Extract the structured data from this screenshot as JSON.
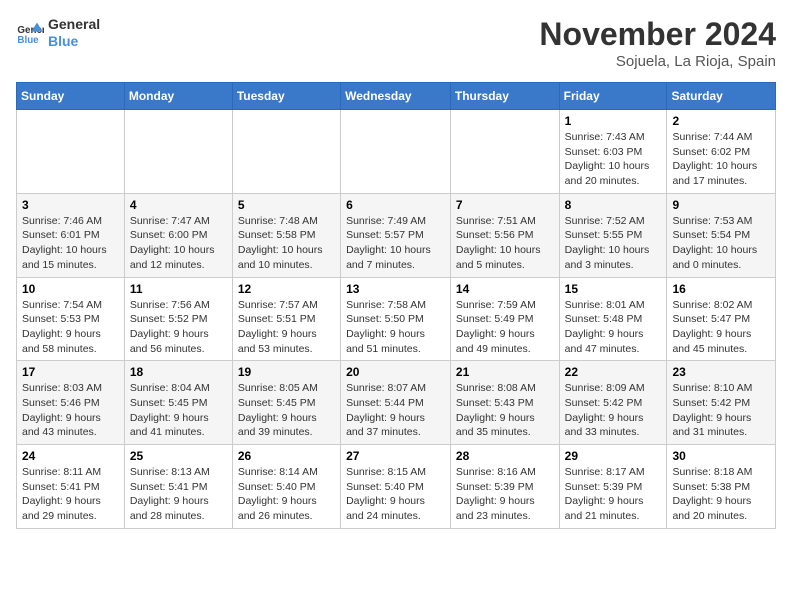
{
  "header": {
    "logo_line1": "General",
    "logo_line2": "Blue",
    "month": "November 2024",
    "location": "Sojuela, La Rioja, Spain"
  },
  "weekdays": [
    "Sunday",
    "Monday",
    "Tuesday",
    "Wednesday",
    "Thursday",
    "Friday",
    "Saturday"
  ],
  "weeks": [
    [
      {
        "day": "",
        "info": ""
      },
      {
        "day": "",
        "info": ""
      },
      {
        "day": "",
        "info": ""
      },
      {
        "day": "",
        "info": ""
      },
      {
        "day": "",
        "info": ""
      },
      {
        "day": "1",
        "info": "Sunrise: 7:43 AM\nSunset: 6:03 PM\nDaylight: 10 hours and 20 minutes."
      },
      {
        "day": "2",
        "info": "Sunrise: 7:44 AM\nSunset: 6:02 PM\nDaylight: 10 hours and 17 minutes."
      }
    ],
    [
      {
        "day": "3",
        "info": "Sunrise: 7:46 AM\nSunset: 6:01 PM\nDaylight: 10 hours and 15 minutes."
      },
      {
        "day": "4",
        "info": "Sunrise: 7:47 AM\nSunset: 6:00 PM\nDaylight: 10 hours and 12 minutes."
      },
      {
        "day": "5",
        "info": "Sunrise: 7:48 AM\nSunset: 5:58 PM\nDaylight: 10 hours and 10 minutes."
      },
      {
        "day": "6",
        "info": "Sunrise: 7:49 AM\nSunset: 5:57 PM\nDaylight: 10 hours and 7 minutes."
      },
      {
        "day": "7",
        "info": "Sunrise: 7:51 AM\nSunset: 5:56 PM\nDaylight: 10 hours and 5 minutes."
      },
      {
        "day": "8",
        "info": "Sunrise: 7:52 AM\nSunset: 5:55 PM\nDaylight: 10 hours and 3 minutes."
      },
      {
        "day": "9",
        "info": "Sunrise: 7:53 AM\nSunset: 5:54 PM\nDaylight: 10 hours and 0 minutes."
      }
    ],
    [
      {
        "day": "10",
        "info": "Sunrise: 7:54 AM\nSunset: 5:53 PM\nDaylight: 9 hours and 58 minutes."
      },
      {
        "day": "11",
        "info": "Sunrise: 7:56 AM\nSunset: 5:52 PM\nDaylight: 9 hours and 56 minutes."
      },
      {
        "day": "12",
        "info": "Sunrise: 7:57 AM\nSunset: 5:51 PM\nDaylight: 9 hours and 53 minutes."
      },
      {
        "day": "13",
        "info": "Sunrise: 7:58 AM\nSunset: 5:50 PM\nDaylight: 9 hours and 51 minutes."
      },
      {
        "day": "14",
        "info": "Sunrise: 7:59 AM\nSunset: 5:49 PM\nDaylight: 9 hours and 49 minutes."
      },
      {
        "day": "15",
        "info": "Sunrise: 8:01 AM\nSunset: 5:48 PM\nDaylight: 9 hours and 47 minutes."
      },
      {
        "day": "16",
        "info": "Sunrise: 8:02 AM\nSunset: 5:47 PM\nDaylight: 9 hours and 45 minutes."
      }
    ],
    [
      {
        "day": "17",
        "info": "Sunrise: 8:03 AM\nSunset: 5:46 PM\nDaylight: 9 hours and 43 minutes."
      },
      {
        "day": "18",
        "info": "Sunrise: 8:04 AM\nSunset: 5:45 PM\nDaylight: 9 hours and 41 minutes."
      },
      {
        "day": "19",
        "info": "Sunrise: 8:05 AM\nSunset: 5:45 PM\nDaylight: 9 hours and 39 minutes."
      },
      {
        "day": "20",
        "info": "Sunrise: 8:07 AM\nSunset: 5:44 PM\nDaylight: 9 hours and 37 minutes."
      },
      {
        "day": "21",
        "info": "Sunrise: 8:08 AM\nSunset: 5:43 PM\nDaylight: 9 hours and 35 minutes."
      },
      {
        "day": "22",
        "info": "Sunrise: 8:09 AM\nSunset: 5:42 PM\nDaylight: 9 hours and 33 minutes."
      },
      {
        "day": "23",
        "info": "Sunrise: 8:10 AM\nSunset: 5:42 PM\nDaylight: 9 hours and 31 minutes."
      }
    ],
    [
      {
        "day": "24",
        "info": "Sunrise: 8:11 AM\nSunset: 5:41 PM\nDaylight: 9 hours and 29 minutes."
      },
      {
        "day": "25",
        "info": "Sunrise: 8:13 AM\nSunset: 5:41 PM\nDaylight: 9 hours and 28 minutes."
      },
      {
        "day": "26",
        "info": "Sunrise: 8:14 AM\nSunset: 5:40 PM\nDaylight: 9 hours and 26 minutes."
      },
      {
        "day": "27",
        "info": "Sunrise: 8:15 AM\nSunset: 5:40 PM\nDaylight: 9 hours and 24 minutes."
      },
      {
        "day": "28",
        "info": "Sunrise: 8:16 AM\nSunset: 5:39 PM\nDaylight: 9 hours and 23 minutes."
      },
      {
        "day": "29",
        "info": "Sunrise: 8:17 AM\nSunset: 5:39 PM\nDaylight: 9 hours and 21 minutes."
      },
      {
        "day": "30",
        "info": "Sunrise: 8:18 AM\nSunset: 5:38 PM\nDaylight: 9 hours and 20 minutes."
      }
    ]
  ]
}
